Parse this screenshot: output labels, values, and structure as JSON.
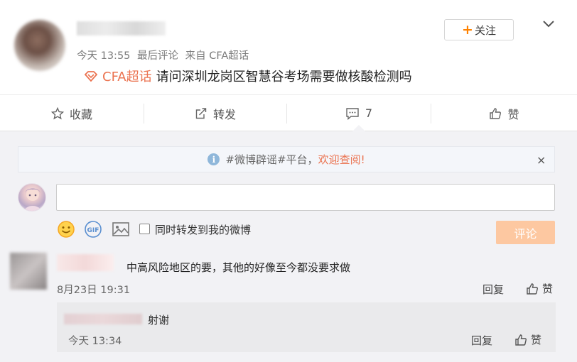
{
  "post": {
    "meta": {
      "time": "今天 13:55",
      "last_comment": "最后评论",
      "source": "来自 CFA超话"
    },
    "topic_tag": "CFA超话",
    "text": "请问深圳龙岗区智慧谷考场需要做核酸检测吗",
    "follow_label": "关注"
  },
  "actions": {
    "favorite": "收藏",
    "repost": "转发",
    "comment_count": "7",
    "like": "赞"
  },
  "notice": {
    "prefix": "#微博辟谣#平台，",
    "highlight": "欢迎查阅!",
    "close": "×"
  },
  "composer": {
    "input_value": "",
    "repost_option": "同时转发到我的微博",
    "submit_label": "评论",
    "submit_color": "#fdc8a1"
  },
  "comments": [
    {
      "text": "中高风险地区的要，其他的好像至今都没要求做",
      "time": "8月23日 19:31",
      "reply_label": "回复",
      "like_label": "赞",
      "replies": [
        {
          "text": "射谢",
          "time": "今天 13:34",
          "reply_label": "回复",
          "like_label": "赞"
        }
      ]
    }
  ],
  "colors": {
    "accent": "#ff8200",
    "topic": "#eb7350",
    "link": "#eb7350"
  }
}
